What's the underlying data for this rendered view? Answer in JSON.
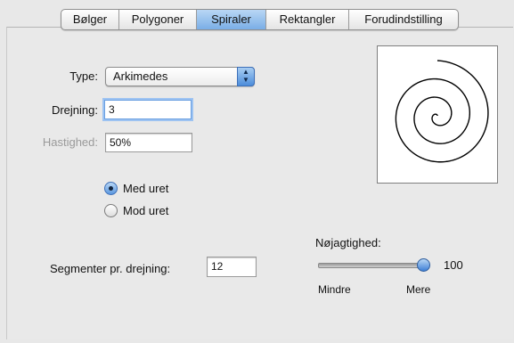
{
  "tabs": [
    {
      "label": "Bølger",
      "active": false
    },
    {
      "label": "Polygoner",
      "active": false
    },
    {
      "label": "Spiraler",
      "active": true
    },
    {
      "label": "Rektangler",
      "active": false
    },
    {
      "label": "Forudindstilling",
      "active": false
    }
  ],
  "form": {
    "type_label": "Type:",
    "type_value": "Arkimedes",
    "drejning_label": "Drejning:",
    "drejning_value": "3",
    "hastighed_label": "Hastighed:",
    "hastighed_value": "50%",
    "radio_med": "Med uret",
    "radio_mod": "Mod uret",
    "segmenter_label": "Segmenter pr. drejning:",
    "segmenter_value": "12"
  },
  "precision": {
    "label": "Nøjagtighed:",
    "value": "100",
    "min_label": "Mindre",
    "max_label": "Mere",
    "fraction": 1.0
  },
  "colors": {
    "accent": "#5a97df",
    "spiral_stroke": "#000000"
  }
}
